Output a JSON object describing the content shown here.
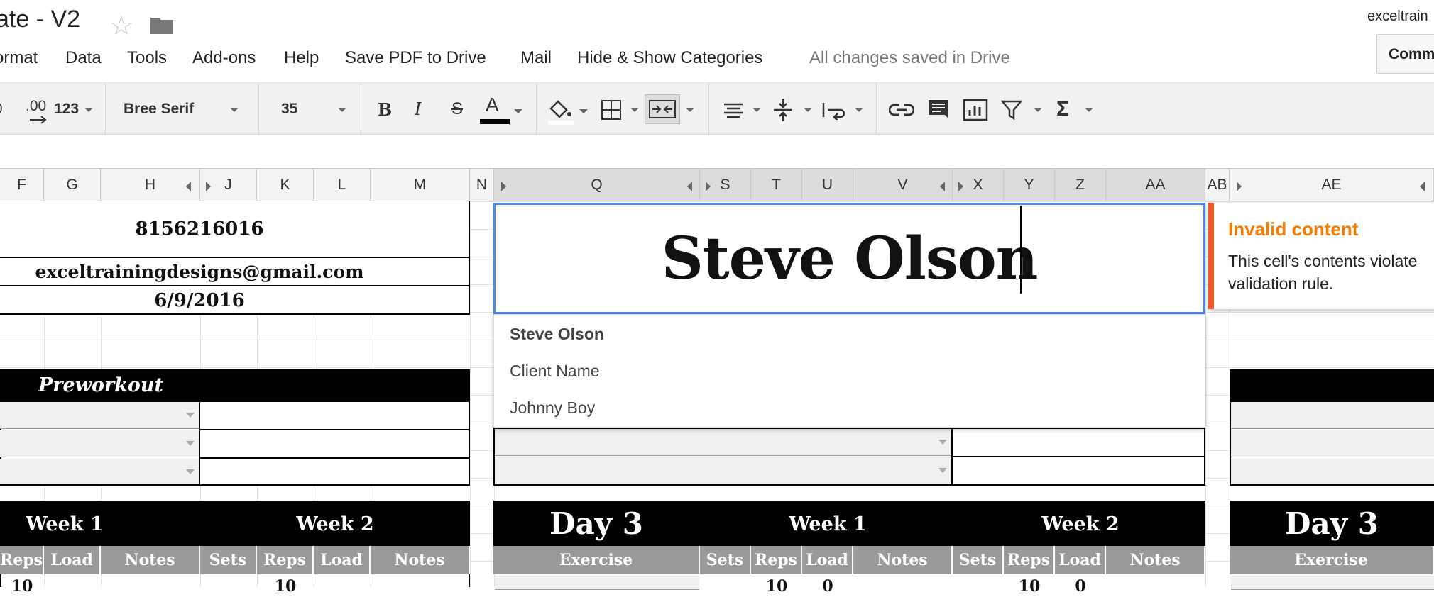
{
  "title": "ate - V2",
  "account": "exceltrain",
  "comments_label": "Comm",
  "menu": [
    "ormat",
    "Data",
    "Tools",
    "Add-ons",
    "Help",
    "Save PDF to Drive",
    "Mail",
    "Hide & Show Categories"
  ],
  "save_status": "All changes saved in Drive",
  "toolbar": {
    "decimal_decrease": ".0",
    "decimal_increase": ".00",
    "number_format": "123",
    "font": "Bree Serif",
    "font_size": "35",
    "bold": "B",
    "italic": "I",
    "strike": "S",
    "text_color": "A",
    "sigma": "Σ"
  },
  "columns": [
    "F",
    "G",
    "H",
    "J",
    "K",
    "L",
    "M",
    "N",
    "Q",
    "S",
    "T",
    "U",
    "V",
    "X",
    "Y",
    "Z",
    "AA",
    "AB",
    "AE"
  ],
  "cells": {
    "phone": "8156216016",
    "email": "exceltrainingdesigns@gmail.com",
    "date": "6/9/2016",
    "preworkout": "Preworkout",
    "day3_a": "Day 3",
    "day3_b": "Day 3",
    "week1_left": "Week 1",
    "week2_left": "Week 2",
    "week1_mid": "Week 1",
    "week2_mid": "Week 2",
    "exercise_mid": "Exercise",
    "exercise_right": "Exercise",
    "h_reps": "Reps",
    "h_load": "Load",
    "h_notes": "Notes",
    "h_sets": "Sets",
    "val_10": "10",
    "val_0": "0"
  },
  "editing_value": "Steve Olson",
  "autocomplete": [
    "Steve Olson",
    "Client Name",
    "Johnny Boy"
  ],
  "validation": {
    "title": "Invalid content",
    "body": "This cell's contents violate validation rule."
  },
  "colors": {
    "accent": "#4a8af4",
    "warning": "#f57c00",
    "warning_bar": "#f05a28"
  }
}
